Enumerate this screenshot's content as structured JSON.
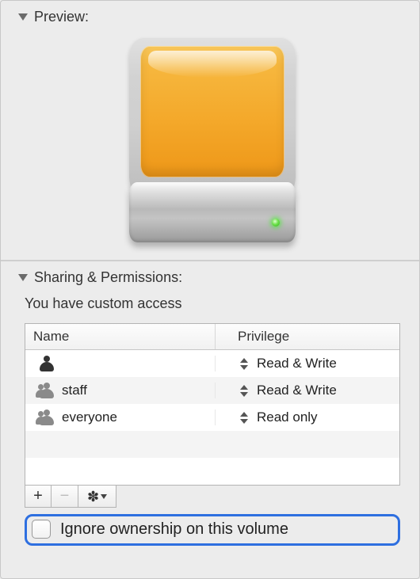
{
  "preview": {
    "title": "Preview:"
  },
  "sharing": {
    "title": "Sharing & Permissions:",
    "access_text": "You have custom access",
    "columns": {
      "name": "Name",
      "privilege": "Privilege"
    },
    "rows": [
      {
        "name": "",
        "privilege": "Read & Write",
        "icon": "single"
      },
      {
        "name": "staff",
        "privilege": "Read & Write",
        "icon": "group"
      },
      {
        "name": "everyone",
        "privilege": "Read only",
        "icon": "group"
      }
    ],
    "ignore_label": "Ignore ownership on this volume",
    "ignore_checked": false
  }
}
